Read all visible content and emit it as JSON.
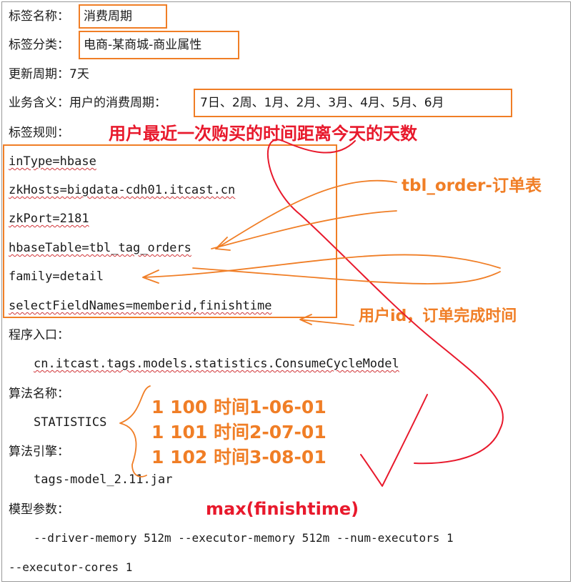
{
  "fields": {
    "tag_name_label": "标签名称：",
    "tag_name_value": "消费周期",
    "tag_category_label": "标签分类：",
    "tag_category_value": "电商-某商城-商业属性",
    "update_cycle_label": "更新周期：",
    "update_cycle_value": "7天",
    "business_meaning_label": "业务含义：",
    "business_meaning_prefix": "用户的消费周期：",
    "business_meaning_values": "7日、2周、1月、2月、3月、4月、5月、6月",
    "tag_rules_label": "标签规则：",
    "entry_label": "程序入口：",
    "entry_value": "cn.itcast.tags.models.statistics.ConsumeCycleModel",
    "algo_name_label": "算法名称：",
    "algo_name_value": "STATISTICS",
    "algo_engine_label": "算法引擎：",
    "algo_engine_value": "tags-model_2.11.jar",
    "model_params_label": "模型参数：",
    "model_params_line1": "--driver-memory  512m  --executor-memory  512m  --num-executors  1",
    "model_params_line2": "--executor-cores 1"
  },
  "rules": [
    "inType=hbase",
    "zkHosts=bigdata-cdh01.itcast.cn",
    "zkPort=2181",
    "hbaseTable=tbl_tag_orders",
    "family=detail",
    "selectFieldNames=memberid,finishtime"
  ],
  "annotations": {
    "recent_days_note": "用户最近一次购买的时间距离今天的天数",
    "order_table_note": "tbl_order-订单表",
    "fields_note": "用户id，订单完成时间",
    "sample_rows": [
      "1   100  时间1-06-01",
      "1   101  时间2-07-01",
      "1   102  时间3-08-01"
    ],
    "max_note": "max(finishtime)"
  },
  "colors": {
    "box_orange": "#f07e26",
    "ink_red": "#e8192c",
    "text": "#1a1a1a"
  }
}
